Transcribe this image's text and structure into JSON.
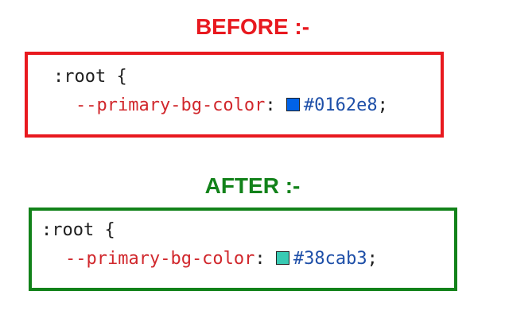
{
  "before": {
    "heading": "BEFORE :-",
    "heading_color": "#e8191f",
    "border_color": "#e8191f",
    "selector": ":root",
    "open_brace": "{",
    "property": "--primary-bg-color",
    "colon": ":",
    "value": "#0162e8",
    "semicolon": ";",
    "swatch_color": "#0162e8"
  },
  "after": {
    "heading": "AFTER :-",
    "heading_color": "#12821a",
    "border_color": "#12821a",
    "selector": ":root",
    "open_brace": "{",
    "property": "--primary-bg-color",
    "colon": ":",
    "value": "#38cab3",
    "semicolon": ";",
    "swatch_color": "#38cab3"
  }
}
